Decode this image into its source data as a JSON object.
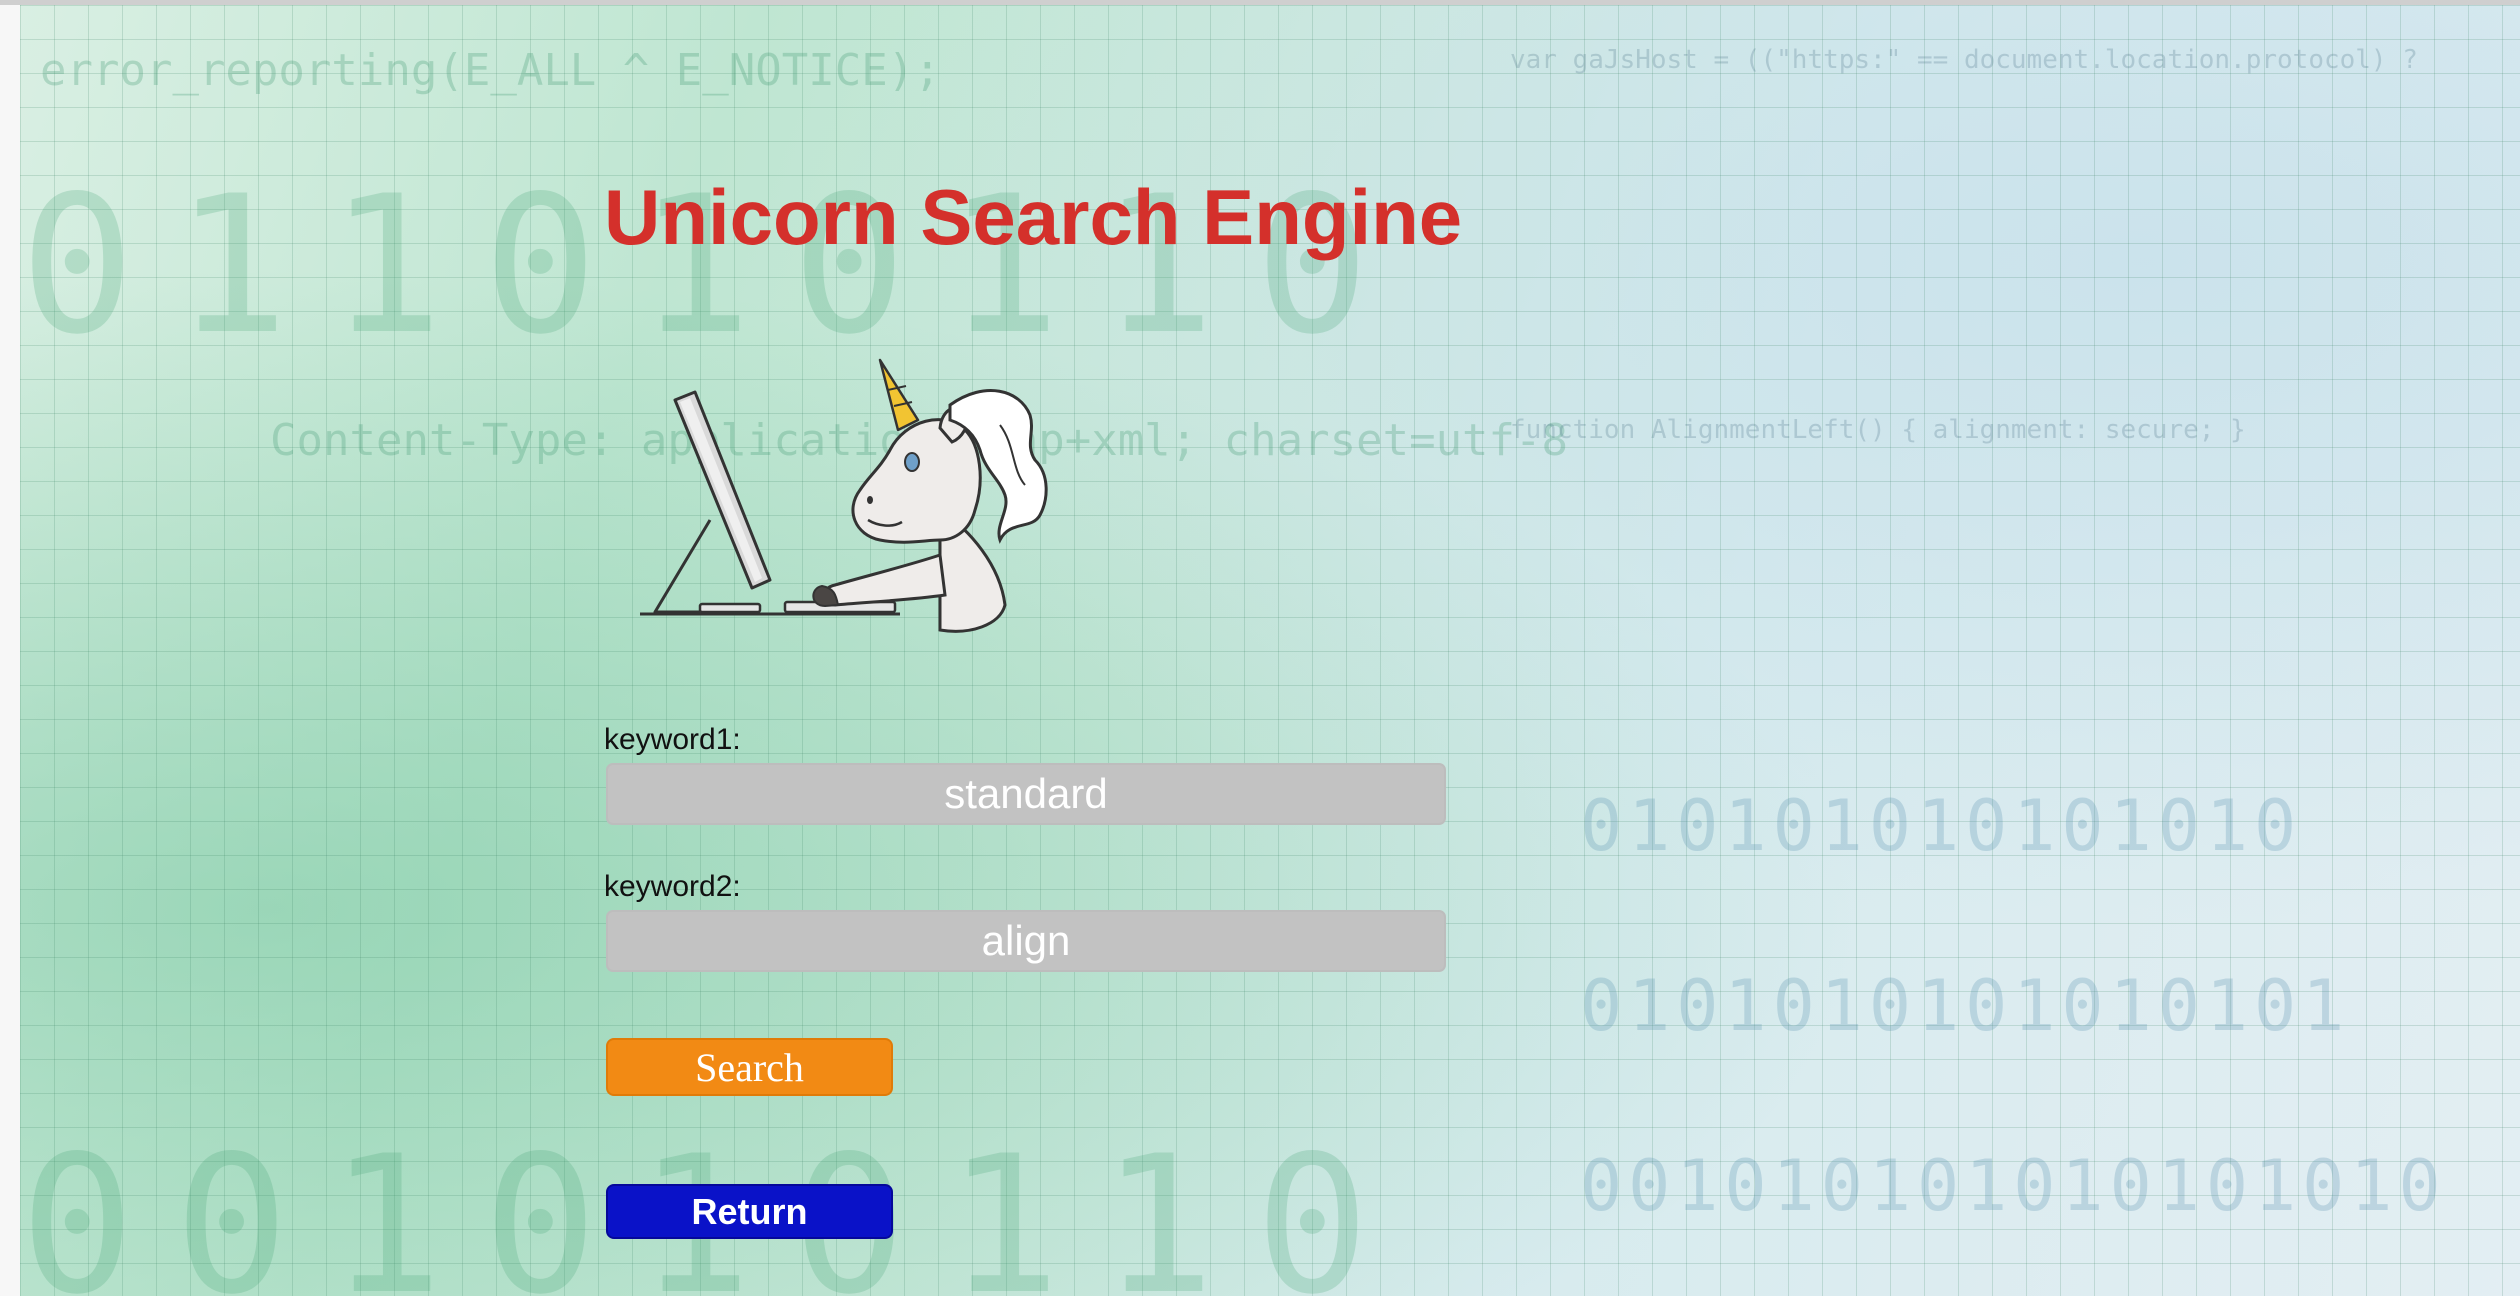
{
  "page": {
    "title": "Unicorn Search Engine"
  },
  "form": {
    "keyword1_label": "keyword1:",
    "keyword1_value": "standard",
    "keyword2_label": "keyword2:",
    "keyword2_value": "align",
    "search_label": "Search",
    "return_label": "Return"
  },
  "icons": {
    "mascot": "unicorn-at-computer-icon"
  },
  "colors": {
    "title": "#d4302b",
    "search_button": "#f28a14",
    "return_button": "#0a12c8",
    "field_background": "#c2c2c2"
  }
}
